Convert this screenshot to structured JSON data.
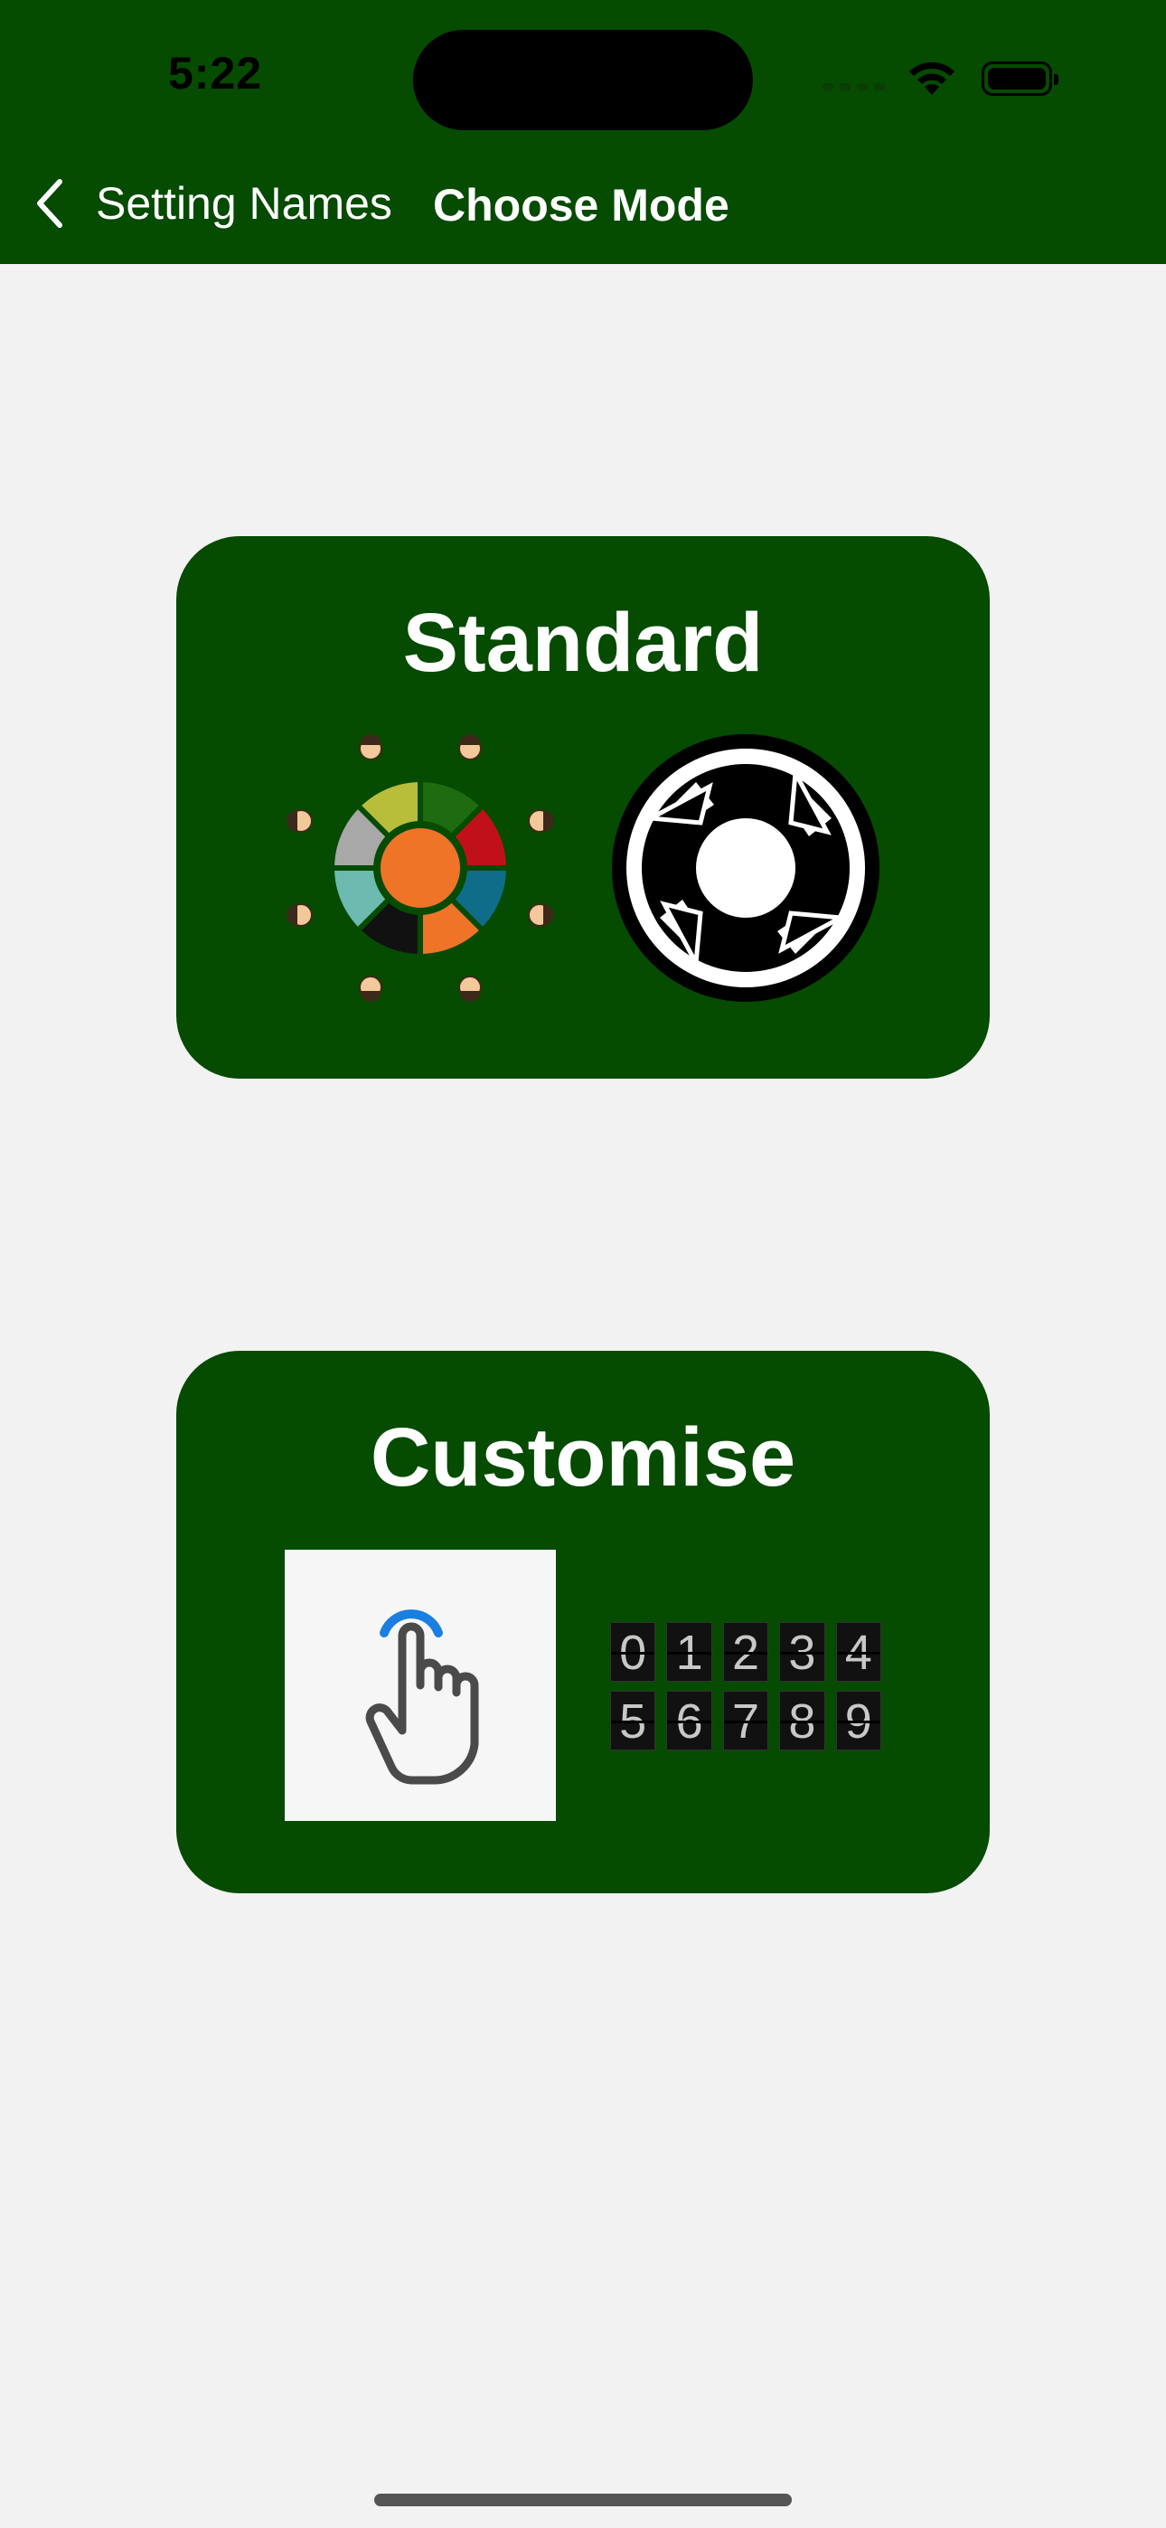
{
  "status_bar": {
    "time": "5:22"
  },
  "nav": {
    "back_label": "Setting Names",
    "title": "Choose Mode"
  },
  "modes": [
    {
      "title": "Standard"
    },
    {
      "title": "Customise",
      "digits_row1": [
        "0",
        "1",
        "2",
        "3",
        "4"
      ],
      "digits_row2": [
        "5",
        "6",
        "7",
        "8",
        "9"
      ]
    }
  ],
  "colors": {
    "brand_green": "#054b00",
    "background": "#f2f2f2"
  }
}
